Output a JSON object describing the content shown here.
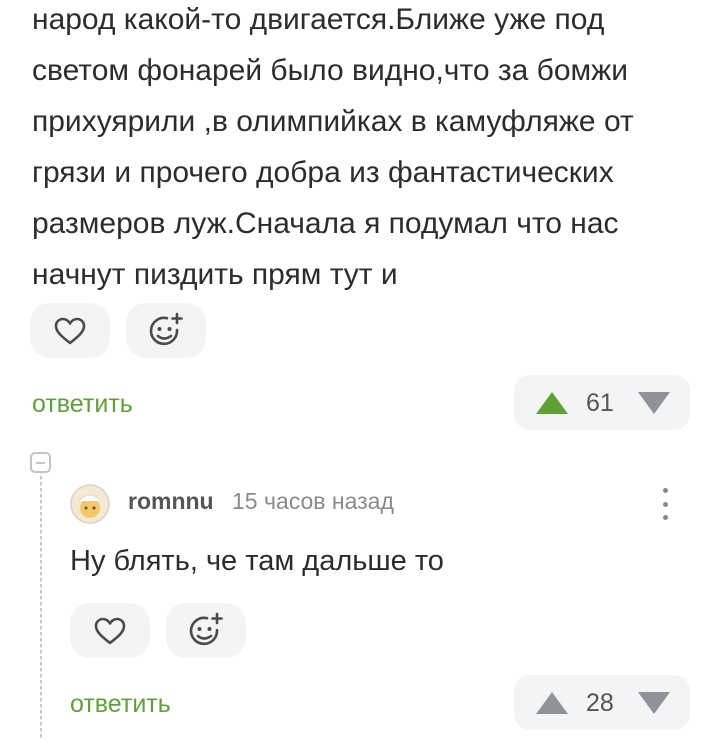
{
  "post": {
    "text_lines": [
      "народ какой-то двигается.Ближе уже под",
      "светом фонарей было видно,что за бомжи",
      "прихуярили ,в олимпийках в камуфляже от",
      "грязи и прочего добра из фантастических",
      "размеров луж.Сначала я подумал что нас",
      "начнут пиздить прям тут и"
    ],
    "reply_label": "ответить",
    "rating": "61"
  },
  "comment": {
    "username": "romnnu",
    "time": "15 часов назад",
    "text": "Ну блять, че там дальше то",
    "reply_label": "ответить",
    "rating": "28"
  },
  "colors": {
    "accent_green": "#5ea137",
    "upvote_active": "#5ea137",
    "vote_neutral": "#8e9399",
    "pill_bg": "#f3f4f5"
  },
  "icons": {
    "like": "heart-icon",
    "react": "smiley-plus-icon",
    "up": "triangle-up-icon",
    "down": "triangle-down-icon",
    "menu": "kebab-menu-icon",
    "collapse": "collapse-minus-icon"
  }
}
